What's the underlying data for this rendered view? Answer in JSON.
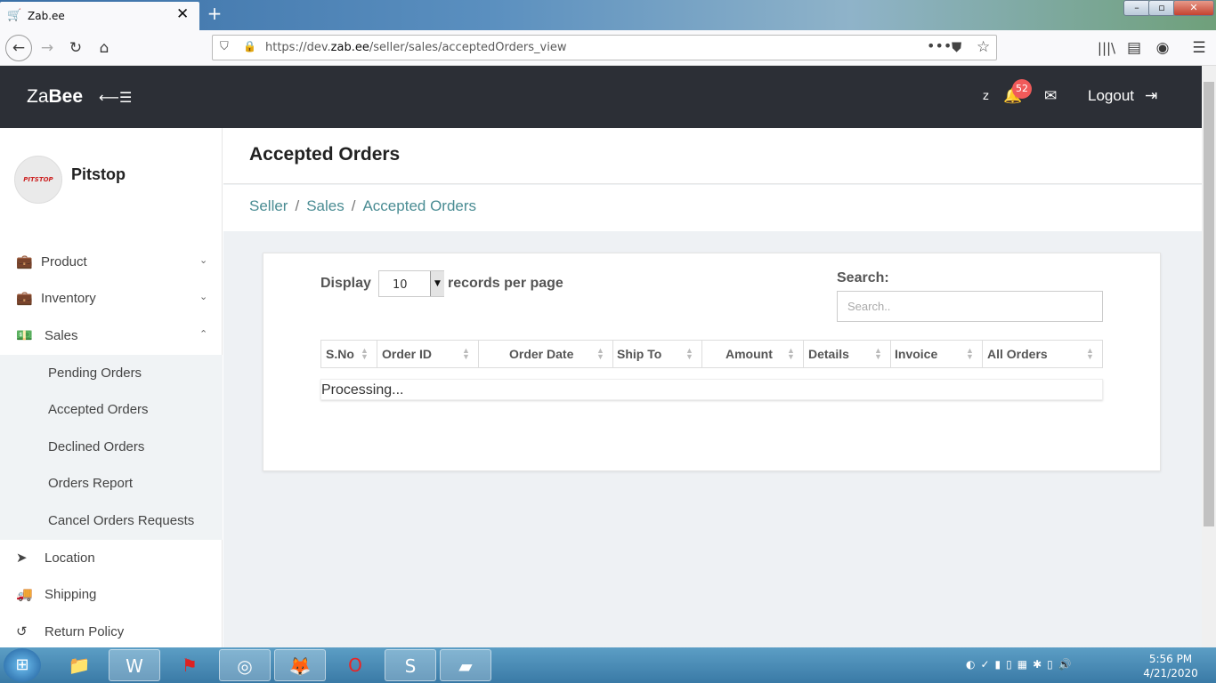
{
  "browser": {
    "tab_title": "Zab.ee",
    "url_prefix": "https://dev.",
    "url_domain": "zab.ee",
    "url_path": "/seller/sales/acceptedOrders_view"
  },
  "header": {
    "logo_light": "Za",
    "logo_bold": "Bee",
    "user_initial": "z",
    "notification_count": "52",
    "logout_label": "Logout"
  },
  "sidebar": {
    "brand": "Pitstop",
    "avatar_text": "PITSTOP",
    "items": [
      {
        "label": "Product",
        "icon": "briefcase-icon"
      },
      {
        "label": "Inventory",
        "icon": "briefcase-icon"
      },
      {
        "label": "Sales",
        "icon": "money-icon"
      }
    ],
    "sales_sub": [
      "Pending Orders",
      "Accepted Orders",
      "Declined Orders",
      "Orders Report",
      "Cancel Orders Requests"
    ],
    "bottom_items": [
      {
        "label": "Location",
        "icon": "location-arrow-icon"
      },
      {
        "label": "Shipping",
        "icon": "truck-icon"
      },
      {
        "label": "Return Policy",
        "icon": "undo-icon"
      }
    ]
  },
  "page": {
    "title": "Accepted Orders",
    "breadcrumb": [
      "Seller",
      "Sales",
      "Accepted Orders"
    ]
  },
  "table": {
    "display_label": "Display",
    "page_length": "10",
    "records_label": "records per page",
    "search_label": "Search:",
    "search_placeholder": "Search..",
    "columns": [
      "S.No",
      "Order ID",
      "Order Date",
      "Ship To",
      "Amount",
      "Details",
      "Invoice",
      "All Orders"
    ],
    "status": "Processing..."
  },
  "taskbar": {
    "time": "5:56 PM",
    "date": "4/21/2020",
    "apps": [
      "explorer",
      "word",
      "acrobat",
      "chrome",
      "firefox",
      "opera",
      "skype",
      "sticky-notes"
    ]
  }
}
